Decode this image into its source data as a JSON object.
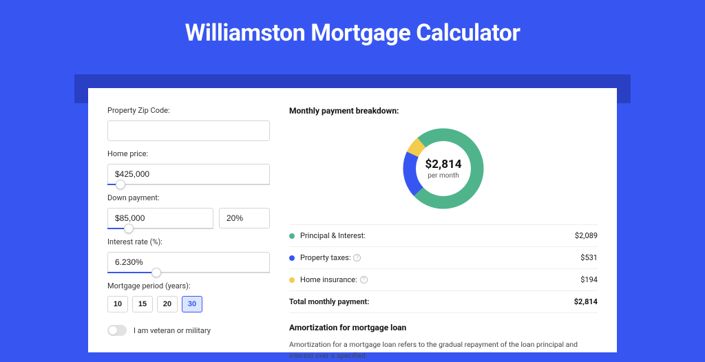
{
  "title": "Williamston Mortgage Calculator",
  "form": {
    "zip_label": "Property Zip Code:",
    "zip_value": "",
    "home_price_label": "Home price:",
    "home_price_value": "$425,000",
    "home_price_slider_pct": 8,
    "down_payment_label": "Down payment:",
    "down_payment_value": "$85,000",
    "down_payment_pct_value": "20%",
    "down_payment_slider_pct": 20,
    "interest_label": "Interest rate (%):",
    "interest_value": "6.230%",
    "interest_slider_pct": 30,
    "period_label": "Mortgage period (years):",
    "periods": [
      "10",
      "15",
      "20",
      "30"
    ],
    "period_active": "30",
    "veteran_label": "I am veteran or military"
  },
  "breakdown": {
    "title": "Monthly payment breakdown:",
    "total_value": "$2,814",
    "total_sub": "per month",
    "rows": [
      {
        "color": "#4fb48c",
        "label": "Principal & Interest:",
        "info": false,
        "value": "$2,089"
      },
      {
        "color": "#3756f1",
        "label": "Property taxes:",
        "info": true,
        "value": "$531"
      },
      {
        "color": "#f3cc4c",
        "label": "Home insurance:",
        "info": true,
        "value": "$194"
      }
    ],
    "total_label": "Total monthly payment:",
    "total_row_value": "$2,814"
  },
  "amort": {
    "title": "Amortization for mortgage loan",
    "text": "Amortization for a mortgage loan refers to the gradual repayment of the loan principal and interest over a specified"
  },
  "chart_data": {
    "type": "pie",
    "title": "Monthly payment breakdown",
    "series": [
      {
        "name": "Principal & Interest",
        "value": 2089,
        "color": "#4fb48c"
      },
      {
        "name": "Property taxes",
        "value": 531,
        "color": "#3756f1"
      },
      {
        "name": "Home insurance",
        "value": 194,
        "color": "#f3cc4c"
      }
    ],
    "total": 2814,
    "center_label": "$2,814",
    "center_sub": "per month"
  }
}
